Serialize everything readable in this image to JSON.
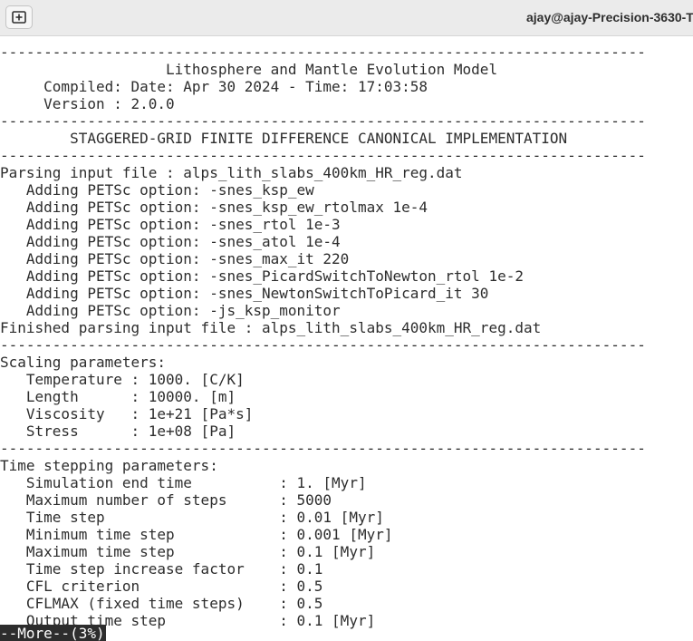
{
  "titlebar": {
    "new_tab_icon": "new-tab-plus-icon",
    "title": "ajay@ajay-Precision-3630-T"
  },
  "terminal": {
    "lines": [
      "--------------------------------------------------------------------------",
      "                   Lithosphere and Mantle Evolution Model",
      "     Compiled: Date: Apr 30 2024 - Time: 17:03:58",
      "     Version : 2.0.0",
      "--------------------------------------------------------------------------",
      "        STAGGERED-GRID FINITE DIFFERENCE CANONICAL IMPLEMENTATION",
      "--------------------------------------------------------------------------",
      "Parsing input file : alps_lith_slabs_400km_HR_reg.dat",
      "   Adding PETSc option: -snes_ksp_ew",
      "   Adding PETSc option: -snes_ksp_ew_rtolmax 1e-4",
      "   Adding PETSc option: -snes_rtol 1e-3",
      "   Adding PETSc option: -snes_atol 1e-4",
      "   Adding PETSc option: -snes_max_it 220",
      "   Adding PETSc option: -snes_PicardSwitchToNewton_rtol 1e-2",
      "   Adding PETSc option: -snes_NewtonSwitchToPicard_it 30",
      "   Adding PETSc option: -js_ksp_monitor",
      "Finished parsing input file : alps_lith_slabs_400km_HR_reg.dat",
      "--------------------------------------------------------------------------",
      "Scaling parameters:",
      "   Temperature : 1000. [C/K]",
      "   Length      : 10000. [m]",
      "   Viscosity   : 1e+21 [Pa*s]",
      "   Stress      : 1e+08 [Pa]",
      "--------------------------------------------------------------------------",
      "Time stepping parameters:",
      "   Simulation end time          : 1. [Myr]",
      "   Maximum number of steps      : 5000",
      "   Time step                    : 0.01 [Myr]",
      "   Minimum time step            : 0.001 [Myr]",
      "   Maximum time step            : 0.1 [Myr]",
      "   Time step increase factor    : 0.1",
      "   CFL criterion                : 0.5",
      "   CFLMAX (fixed time steps)    : 0.5",
      "   Output time step             : 0.1 [Myr]"
    ],
    "pager_prompt": "--More--(3%)"
  }
}
